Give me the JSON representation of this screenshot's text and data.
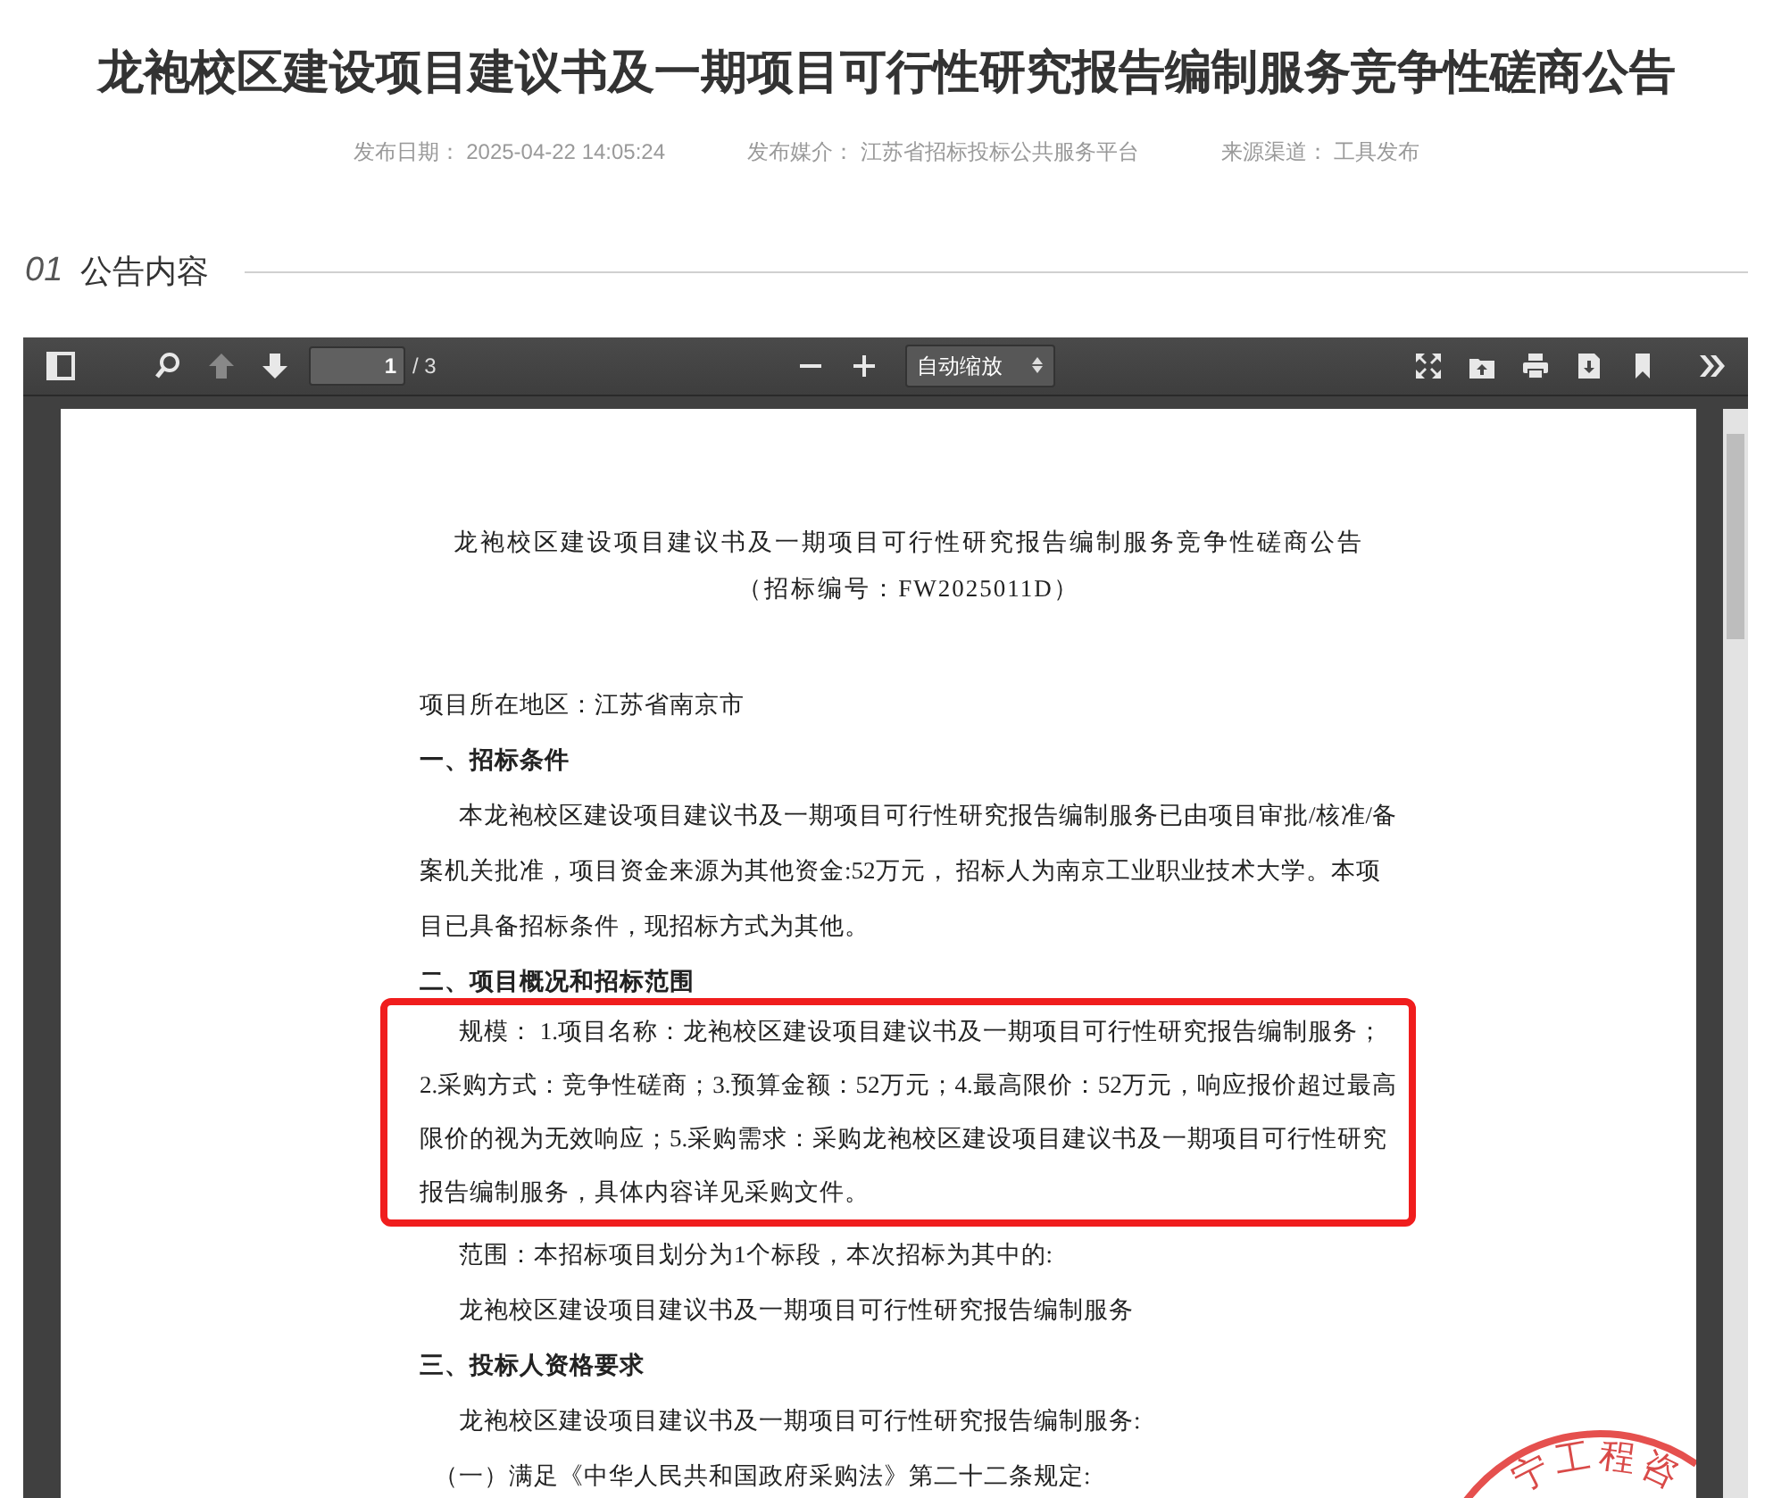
{
  "title": "龙袍校区建设项目建议书及一期项目可行性研究报告编制服务竞争性磋商公告",
  "meta": [
    {
      "label": "发布日期：",
      "value": "2025-04-22 14:05:24"
    },
    {
      "label": "发布媒介：",
      "value": "江苏省招标投标公共服务平台"
    },
    {
      "label": "来源渠道：",
      "value": "工具发布"
    }
  ],
  "section": {
    "number": "01",
    "title": "公告内容"
  },
  "viewer": {
    "toolbar": {
      "prev_disabled": true,
      "next_disabled": false,
      "page": "1",
      "page_count": "/ 3",
      "zoom": "自动缩放"
    },
    "document": [
      {
        "kind": "center",
        "text": "龙袍校区建设项目建议书及一期项目可行性研究报告编制服务竞争性磋商公告"
      },
      {
        "kind": "center",
        "text": "（招标编号：FW2025011D）"
      },
      {
        "kind": "line",
        "text": "项目所在地区：江苏省南京市"
      },
      {
        "kind": "heading",
        "text": "一、招标条件"
      },
      {
        "kind": "para",
        "text": "本龙袍校区建设项目建议书及一期项目可行性研究报告编制服务已由项目审批/核准/备案机关批准，项目资金来源为其他资金:52万元，  招标人为南京工业职业技术大学。本项目已具备招标条件，现招标方式为其他。"
      },
      {
        "kind": "heading",
        "text": "二、项目概况和招标范围"
      },
      {
        "kind": "highlight",
        "text": "规模：  1.项目名称：龙袍校区建设项目建议书及一期项目可行性研究报告编制服务；2.采购方式：竞争性磋商；3.预算金额：52万元；4.最高限价：52万元，响应报价超过最高限价的视为无效响应；5.采购需求：采购龙袍校区建设项目建议书及一期项目可行性研究报告编制服务，具体内容详见采购文件。"
      },
      {
        "kind": "para",
        "text": "范围：本招标项目划分为1个标段，本次招标为其中的:"
      },
      {
        "kind": "para",
        "text": "龙袍校区建设项目建议书及一期项目可行性研究报告编制服务"
      },
      {
        "kind": "heading",
        "text": "三、投标人资格要求"
      },
      {
        "kind": "para",
        "text": "龙袍校区建设项目建议书及一期项目可行性研究报告编制服务:"
      },
      {
        "kind": "sub",
        "text": "（一）满足《中华人民共和国政府采购法》第二十二条规定:"
      }
    ],
    "stamp_text": "宁工程咨"
  }
}
